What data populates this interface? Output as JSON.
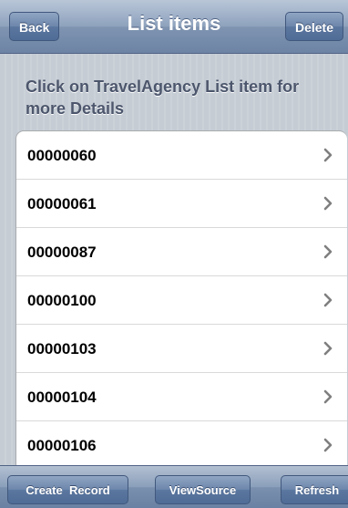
{
  "navbar": {
    "title": "List items",
    "back_label": "Back",
    "delete_label": "Delete"
  },
  "header": {
    "text": "Click on TravelAgency List item for more Details"
  },
  "list": {
    "items": [
      {
        "label": "00000060",
        "icon": "chevron-right-icon"
      },
      {
        "label": "00000061",
        "icon": "chevron-right-icon"
      },
      {
        "label": "00000087",
        "icon": "chevron-right-icon"
      },
      {
        "label": "00000100",
        "icon": "chevron-right-icon"
      },
      {
        "label": "00000103",
        "icon": "chevron-right-icon"
      },
      {
        "label": "00000104",
        "icon": "chevron-right-icon"
      },
      {
        "label": "00000106",
        "icon": "chevron-right-icon"
      }
    ]
  },
  "toolbar": {
    "create_label": "Create  Record",
    "view_source_label": "ViewSource",
    "refresh_label": "Refresh"
  },
  "colors": {
    "nav_blue": "#6d84a5",
    "background_stripe": "#c5ccd4",
    "header_text": "#4c566c"
  }
}
